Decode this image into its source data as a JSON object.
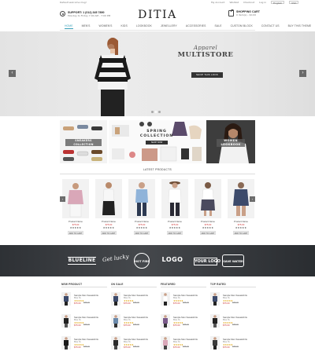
{
  "topbar": {
    "welcome": "Default welcome msg!",
    "links": [
      "My Account",
      "Wishlist",
      "Checkout",
      "Log in"
    ],
    "language": "English",
    "currency": "USD"
  },
  "header": {
    "support_title": "SUPPORT: 1 (012) 345 7890",
    "support_sub": "Monday to Friday 7:00 AM - 7:00 PM",
    "logo": "DITIA",
    "cart_title": "SHOPPING CART",
    "cart_sub": "0 item(s) - $0.00"
  },
  "nav": [
    "HOME",
    "MEN'S",
    "WOMEN'S",
    "KIDS",
    "LOOKBOOK",
    "JEWELLERY",
    "ACCESSORIES",
    "SALE",
    "CUSTOM BLOCK",
    "CONTACT US",
    "BUY THIS THEME"
  ],
  "hero": {
    "subtitle": "Apparel",
    "title": "MULTISTORE",
    "button": "SHOP THIS LOOK"
  },
  "banners": {
    "shoes_label": "SNEAKERS COLLECTION",
    "spring_title": "SPRING",
    "spring_sub": "COLLECTION",
    "spring_btn": "SHOP NOW",
    "women_label": "WOMEN LOOKBOOK"
  },
  "latest": {
    "title": "LATEST PRODUCTS",
    "products": [
      {
        "name": "Product Name",
        "price": "$75.00",
        "stars": "★★★★★",
        "btn": "ADD TO CART",
        "color": "#d9a7b8"
      },
      {
        "name": "Product Name",
        "price": "$75.00",
        "stars": "★★★★★",
        "btn": "ADD TO CART",
        "color": "#222222"
      },
      {
        "name": "Product Name",
        "price": "$75.00",
        "stars": "★★★★★",
        "btn": "ADD TO CART",
        "color": "#8fb3d9"
      },
      {
        "name": "Product Name",
        "price": "$75.00",
        "stars": "★★★★★",
        "btn": "ADD TO CART",
        "color": "#ffffff"
      },
      {
        "name": "Product Name",
        "price": "$75.00",
        "stars": "★★★★★",
        "btn": "ADD TO CART",
        "color": "#4a4a5e"
      },
      {
        "name": "Product Name",
        "price": "$75.00",
        "stars": "★★★★★",
        "btn": "ADD TO CART",
        "color": "#3c4a6b"
      }
    ]
  },
  "brands": [
    "BLUELINE",
    "Get lucky",
    "HOT FIRE",
    "LOGO",
    "YOUR LOGO",
    "SAVE WATER"
  ],
  "columns": [
    {
      "title": "NEW PRODUCT",
      "items": [
        {
          "name": "Sample Men Sweatshirts",
          "sub": "Blue XL",
          "stars": "★★★★★",
          "price": "$75.00",
          "old": "$85.00"
        },
        {
          "name": "Sample Men Sweatshirts",
          "sub": "Blue XL",
          "stars": "★★★★★",
          "price": "$75.00",
          "old": "$85.00"
        },
        {
          "name": "Sample Men Sweatshirts",
          "sub": "Blue XL",
          "stars": "★★★★★",
          "price": "$75.00",
          "old": "$85.00"
        }
      ]
    },
    {
      "title": "ON SALE",
      "items": [
        {
          "name": "Sample Men Sweatshirts",
          "sub": "Blue XL",
          "stars": "★★★★★",
          "price": "$75.00",
          "old": "$85.00"
        },
        {
          "name": "Sample Men Sweatshirts",
          "sub": "Blue XL",
          "stars": "★★★★★",
          "price": "$75.00",
          "old": "$85.00"
        },
        {
          "name": "Sample Men Sweatshirts",
          "sub": "Blue XL",
          "stars": "★★★★★",
          "price": "$75.00",
          "old": "$85.00"
        }
      ]
    },
    {
      "title": "FEATURED",
      "items": [
        {
          "name": "Sample Men Sweatshirts",
          "sub": "Blue XL",
          "stars": "★★★★★",
          "price": "$75.00",
          "old": "$85.00"
        },
        {
          "name": "Sample Men Sweatshirts",
          "sub": "Blue XL",
          "stars": "★★★★★",
          "price": "$75.00",
          "old": "$85.00"
        },
        {
          "name": "Sample Men Sweatshirts",
          "sub": "Blue XL",
          "stars": "★★★★★",
          "price": "$75.00",
          "old": "$85.00"
        }
      ]
    },
    {
      "title": "TOP RATED",
      "items": [
        {
          "name": "Sample Men Sweatshirts",
          "sub": "Blue XL",
          "stars": "★★★★★",
          "price": "$75.00",
          "old": "$85.00"
        },
        {
          "name": "Sample Men Sweatshirts",
          "sub": "Blue XL",
          "stars": "★★★★★",
          "price": "$75.00",
          "old": "$85.00"
        },
        {
          "name": "Sample Men Sweatshirts",
          "sub": "Blue XL",
          "stars": "★★★★★",
          "price": "$75.00",
          "old": "$85.00"
        }
      ]
    }
  ],
  "colors": {
    "accent": "#3aa0b8",
    "price": "#cc3333",
    "dark": "#333333"
  }
}
